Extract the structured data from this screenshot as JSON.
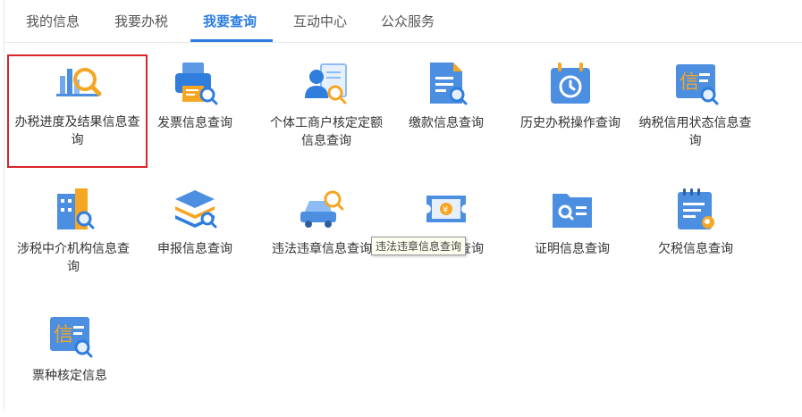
{
  "tabs": [
    {
      "label": "我的信息"
    },
    {
      "label": "我要办税"
    },
    {
      "label": "我要查询"
    },
    {
      "label": "互动中心"
    },
    {
      "label": "公众服务"
    }
  ],
  "active_tab": "我要查询",
  "accent_color": "#2b7de0",
  "highlight_color": "#d9252b",
  "items": [
    {
      "label": "办税进度及结果信息查询",
      "icon": "bar-chart-search-icon"
    },
    {
      "label": "发票信息查询",
      "icon": "printer-search-icon"
    },
    {
      "label": "个体工商户核定定额信息查询",
      "icon": "person-card-search-icon"
    },
    {
      "label": "缴款信息查询",
      "icon": "document-search-icon"
    },
    {
      "label": "历史办税操作查询",
      "icon": "calendar-history-icon"
    },
    {
      "label": "纳税信用状态信息查询",
      "icon": "credit-search-icon"
    },
    {
      "label": "涉税中介机构信息查询",
      "icon": "building-search-icon"
    },
    {
      "label": "申报信息查询",
      "icon": "stack-search-icon"
    },
    {
      "label": "违法违章信息查询",
      "icon": "car-search-icon"
    },
    {
      "label": "税费缴纳查询",
      "icon": "ticket-icon"
    },
    {
      "label": "证明信息查询",
      "icon": "folder-search-icon"
    },
    {
      "label": "欠税信息查询",
      "icon": "notepad-search-icon"
    },
    {
      "label": "票种核定信息",
      "icon": "credit-search-icon"
    }
  ],
  "tooltip": "违法违章信息查询"
}
